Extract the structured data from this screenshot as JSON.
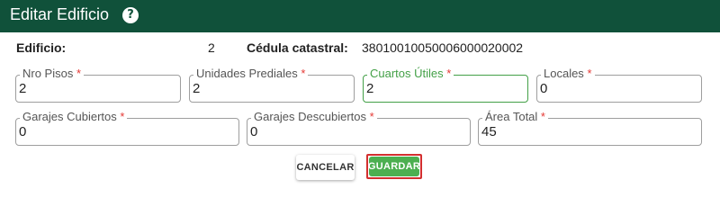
{
  "header": {
    "title": "Editar Edificio",
    "help_icon": "help-circle-icon",
    "background": "#10513a"
  },
  "info": {
    "edificio_label": "Edificio:",
    "edificio_value": "2",
    "cedula_label": "Cédula catastral:",
    "cedula_value": "38010010050006000020002"
  },
  "fields": {
    "nro_pisos": {
      "label": "Nro Pisos",
      "value": "2"
    },
    "unidades_prediales": {
      "label": "Unidades Prediales",
      "value": "2"
    },
    "cuartos_utiles": {
      "label": "Cuartos Útiles",
      "value": "2"
    },
    "locales": {
      "label": "Locales",
      "value": "0"
    },
    "garajes_cubiertos": {
      "label": "Garajes Cubiertos",
      "value": "0"
    },
    "garajes_descubiertos": {
      "label": "Garajes Descubiertos",
      "value": "0"
    },
    "area_total": {
      "label": "Área Total",
      "value": "45"
    },
    "required_mark": "*"
  },
  "buttons": {
    "cancel_label": "CANCELAR",
    "save_label": "GUARDAR"
  },
  "colors": {
    "accent": "#43a047",
    "save_button": "#4caf50",
    "highlight_border": "#d32f2f",
    "required": "#e53935"
  }
}
